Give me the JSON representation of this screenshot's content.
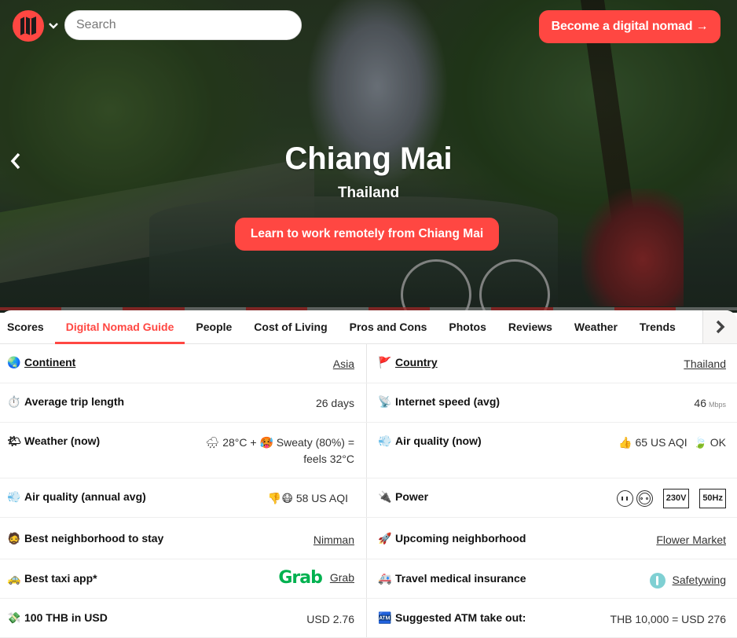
{
  "colors": {
    "brand": "#ff4742",
    "grab_green": "#00b14f"
  },
  "header": {
    "logo_icon": "map-icon",
    "dropdown_icon": "chevron-down-icon",
    "search_placeholder": "Search",
    "cta_label": "Become a digital nomad →"
  },
  "hero": {
    "title": "Chiang Mai",
    "subtitle": "Thailand",
    "cta_label": "Learn to work remotely from Chiang Mai",
    "prev_icon": "chevron-left-icon",
    "segments": [
      "red",
      "grey",
      "red",
      "grey",
      "red",
      "grey",
      "red",
      "grey",
      "red",
      "grey",
      "red",
      "grey"
    ]
  },
  "tabs": {
    "items": [
      {
        "label": "Scores",
        "active": false
      },
      {
        "label": "Digital Nomad Guide",
        "active": true
      },
      {
        "label": "People",
        "active": false
      },
      {
        "label": "Cost of Living",
        "active": false
      },
      {
        "label": "Pros and Cons",
        "active": false
      },
      {
        "label": "Photos",
        "active": false
      },
      {
        "label": "Reviews",
        "active": false
      },
      {
        "label": "Weather",
        "active": false
      },
      {
        "label": "Trends",
        "active": false
      }
    ],
    "next_icon": "chevron-right-icon"
  },
  "guide": {
    "continent": {
      "icon": "globe-icon",
      "glyph": "🌏",
      "label": "Continent",
      "value": "Asia"
    },
    "country": {
      "icon": "flag-icon",
      "glyph": "🚩",
      "label": "Country",
      "value": "Thailand"
    },
    "trip_length": {
      "icon": "stopwatch-icon",
      "glyph": "⏱️",
      "label": "Average trip length",
      "value": "26 days"
    },
    "internet": {
      "icon": "satellite-dish-icon",
      "glyph": "📡",
      "label": "Internet speed (avg)",
      "value": "46",
      "unit": "Mbps"
    },
    "weather": {
      "icon": "sun-cloud-icon",
      "glyph": "🌤",
      "label": "Weather (now)",
      "cond_glyph": "🌧",
      "temp": "28°C +",
      "humid_glyph": "🥵",
      "humidity": "Sweaty (80%) =",
      "feels": "feels 32°C"
    },
    "air_now": {
      "icon": "wind-icon",
      "glyph": "💨",
      "label": "Air quality (now)",
      "thumb_glyph": "👍",
      "aqi": "65 US AQI",
      "leaf_glyph": "🍃",
      "status": "OK"
    },
    "air_annual": {
      "icon": "wind-icon",
      "glyph": "💨",
      "label": "Air quality (annual avg)",
      "thumb_glyph": "👎",
      "mask_glyph": "😷",
      "aqi": "58 US AQI"
    },
    "power": {
      "icon": "plug-icon",
      "glyph": "🔌",
      "label": "Power",
      "voltage": "230V",
      "frequency": "50Hz"
    },
    "best_hood": {
      "icon": "person-icon",
      "glyph": "🧔",
      "label": "Best neighborhood to stay",
      "value": "Nimman"
    },
    "upcoming_hood": {
      "icon": "rocket-icon",
      "glyph": "🚀",
      "label": "Upcoming neighborhood",
      "value": "Flower Market"
    },
    "taxi": {
      "icon": "taxi-icon",
      "glyph": "🚕",
      "label": "Best taxi app*",
      "logo_text": "Grab",
      "value": "Grab"
    },
    "insurance": {
      "icon": "ambulance-icon",
      "glyph": "🚑",
      "label": "Travel medical insurance",
      "value": "Safetywing"
    },
    "fx": {
      "icon": "money-icon",
      "glyph": "💸",
      "label": "100 THB in USD",
      "value": "USD 2.76"
    },
    "atm": {
      "icon": "atm-icon",
      "glyph": "🏧",
      "label": "Suggested ATM take out:",
      "value": "THB 10,000 = USD 276"
    }
  }
}
